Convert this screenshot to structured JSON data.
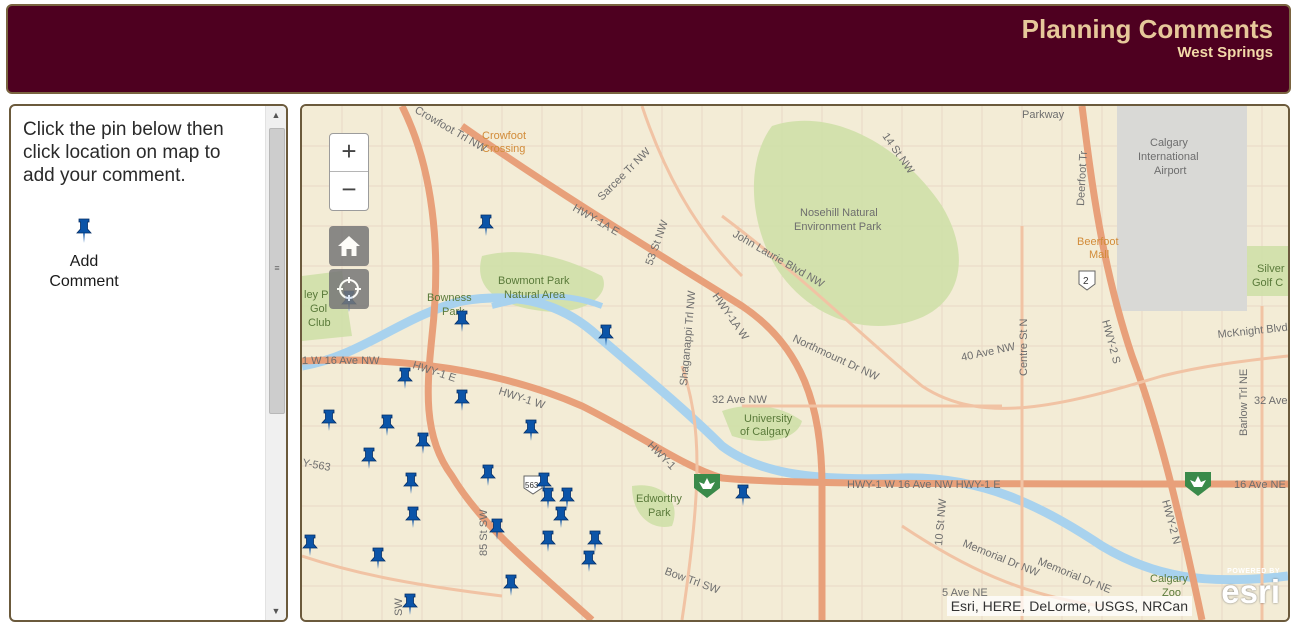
{
  "header": {
    "title": "Planning Comments",
    "subtitle": "West Springs",
    "background_color": "#4e0020",
    "title_color": "#e6c89a"
  },
  "sidebar": {
    "instructions": "Click the pin below then click location on map to add your comment.",
    "add_comment_label_line1": "Add",
    "add_comment_label_line2": "Comment",
    "pin_icon": "pushpin-icon",
    "pin_color": "#0b54a8"
  },
  "map": {
    "zoom_in_label": "+",
    "zoom_out_label": "−",
    "home_icon": "home-icon",
    "locate_icon": "locate-crosshair-icon",
    "attribution": "Esri, HERE, DeLorme, USGS, NRCan",
    "logo_powered": "POWERED BY",
    "logo_word": "esri",
    "labels": {
      "crowfoot": [
        "Crowfoot",
        "Crossing"
      ],
      "calgary_airport": [
        "Calgary",
        "International",
        "Airport"
      ],
      "nosehill": [
        "Nosehill Natural",
        "Environment Park"
      ],
      "beerfoot": [
        "Beerfoot",
        "Mall"
      ],
      "bowmont": [
        "Bowmont Park",
        "Natural Area"
      ],
      "bowness": [
        "Bowness",
        "Park"
      ],
      "golf": [
        "ley P",
        "Gol",
        "Club"
      ],
      "silver_golf": [
        "Silver",
        "Golf C"
      ],
      "uofc": [
        "University",
        "of Calgary"
      ],
      "edworthy": [
        "Edworthy",
        "Park"
      ],
      "calgary_zoo": [
        "Calgary",
        "Zoo"
      ],
      "parkway": "Parkway",
      "crowfoot_trl": "Crowfoot Trl NW",
      "sarcee": "Sarcee Tr NW",
      "st53": "53 St NW",
      "st14": "14 St NW",
      "hwy1a_e": "HWY-1A E",
      "hwy1a_w": "HWY-1A W",
      "jl_blvd": "John Laurie Blvd NW",
      "shaganappi": "Shaganappi Trl NW",
      "northmount": "Northmount Dr NW",
      "ave40": "40 Ave NW",
      "centre": "Centre St N",
      "deerfoot": "Deerfoot Tr",
      "mcknight": "McKnight Blvd",
      "barlow": "Barlow Trl NE",
      "ave32_ne": "32 Ave",
      "hwy2s": "HWY-2 S",
      "hwy2n": "HWY-2 N",
      "ave32_nw": "32 Ave NW",
      "ave16_left": "1 W 16 Ave NW",
      "hwy1e": "HWY-1 E",
      "hwy1w": "HWY-1 W",
      "hwy1": "HWY-1",
      "hwy1_16": "HWY-1 W 16 Ave NW  HWY-1 E",
      "ave16_ne": "16 Ave NE",
      "st10": "10 St NW",
      "memorial": "Memorial Dr NW",
      "memorial2": "Memorial Dr NE",
      "bow": "Bow Trl SW",
      "st85": "85 St SW",
      "hwy563": "Y-563",
      "route2": "2",
      "route563": "563",
      "s_w": "SW",
      "ave5": "5 Ave NE"
    }
  }
}
